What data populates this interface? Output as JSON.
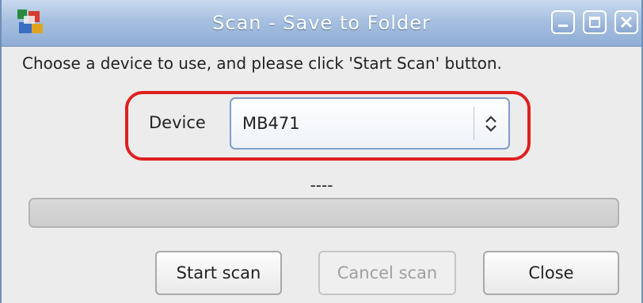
{
  "window": {
    "title": "Scan - Save to Folder",
    "app_icon": "scanner-app-icon",
    "controls": [
      {
        "name": "minimize-icon"
      },
      {
        "name": "maximize-icon"
      },
      {
        "name": "close-icon"
      }
    ]
  },
  "instructions": "Choose a device to use, and please click 'Start Scan' button.",
  "device": {
    "label": "Device",
    "selected": "MB471",
    "highlight_color": "#e02020"
  },
  "status": "----",
  "progress": {
    "value": 0
  },
  "buttons": {
    "start": "Start scan",
    "cancel": "Cancel scan",
    "close": "Close"
  }
}
